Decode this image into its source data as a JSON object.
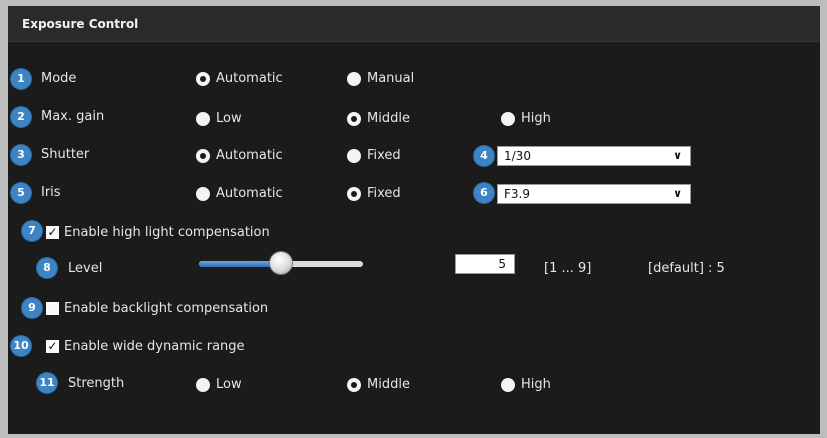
{
  "header": {
    "title": "Exposure Control"
  },
  "rows": {
    "mode": {
      "badge": "1",
      "label": "Mode",
      "options": [
        {
          "label": "Automatic",
          "selected": true
        },
        {
          "label": "Manual",
          "selected": false
        }
      ]
    },
    "max_gain": {
      "badge": "2",
      "label": "Max. gain",
      "options": [
        {
          "label": "Low",
          "selected": false
        },
        {
          "label": "Middle",
          "selected": true
        },
        {
          "label": "High",
          "selected": false
        }
      ]
    },
    "shutter": {
      "badge": "3",
      "label": "Shutter",
      "options": [
        {
          "label": "Automatic",
          "selected": true
        },
        {
          "label": "Fixed",
          "selected": false
        }
      ],
      "select_badge": "4",
      "select_value": "1/30"
    },
    "iris": {
      "badge": "5",
      "label": "Iris",
      "options": [
        {
          "label": "Automatic",
          "selected": false
        },
        {
          "label": "Fixed",
          "selected": true
        }
      ],
      "select_badge": "6",
      "select_value": "F3.9"
    },
    "high_light": {
      "badge": "7",
      "label": "Enable high light compensation",
      "checked": true
    },
    "level": {
      "badge": "8",
      "label": "Level",
      "value": "5",
      "range": "[1 ... 9]",
      "default": "[default] : 5",
      "slider_fraction": 0.5
    },
    "backlight": {
      "badge": "9",
      "label": "Enable backlight compensation",
      "checked": false
    },
    "wdr": {
      "badge": "10",
      "label": "Enable wide dynamic range",
      "checked": true
    },
    "strength": {
      "badge": "11",
      "label": "Strength",
      "options": [
        {
          "label": "Low",
          "selected": false
        },
        {
          "label": "Middle",
          "selected": true
        },
        {
          "label": "High",
          "selected": false
        }
      ]
    }
  },
  "colors": {
    "badge": "#3d84c5",
    "panel_bg": "#1b1b1b",
    "header_bg": "#2a2a2a",
    "slider_fill": "#3f7fc4"
  }
}
